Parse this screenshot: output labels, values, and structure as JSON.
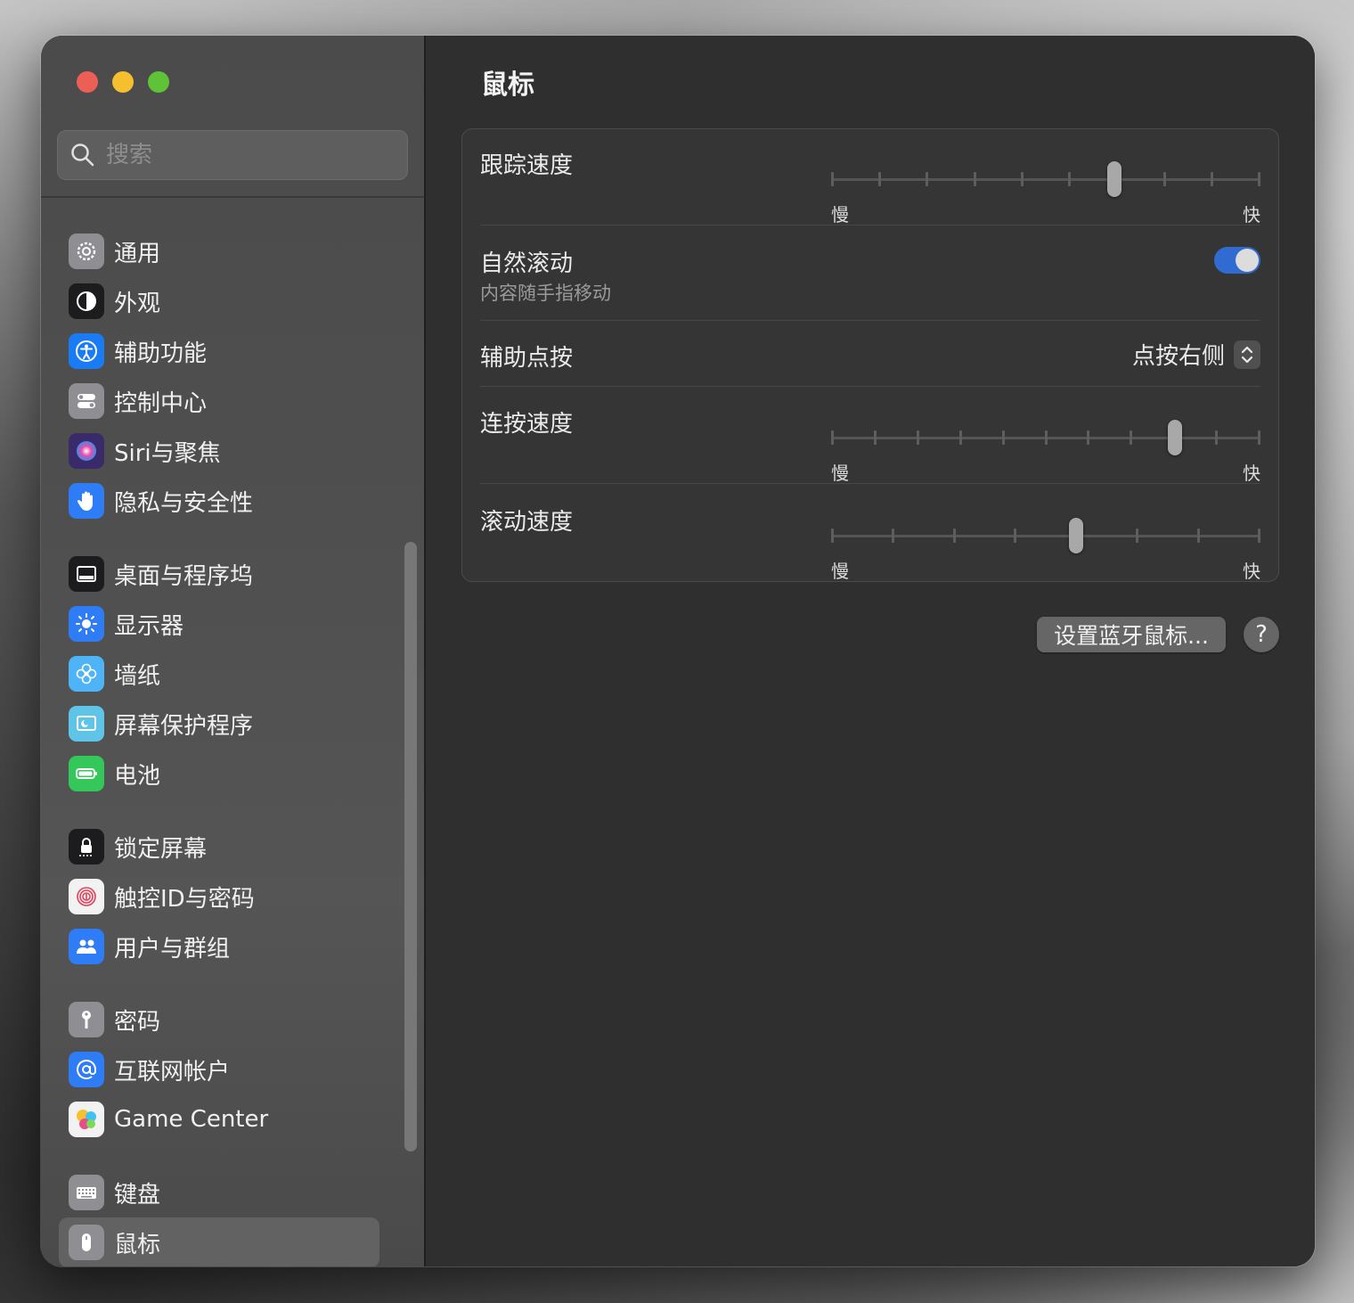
{
  "window": {
    "traffic_lights": [
      "close",
      "minimize",
      "zoom"
    ]
  },
  "search": {
    "placeholder": "搜索"
  },
  "sidebar": {
    "groups": [
      [
        {
          "label": "通用",
          "icon": "gear-icon",
          "color": "#8e8e93"
        },
        {
          "label": "外观",
          "icon": "appearance-icon",
          "color": "#1c1c1e"
        },
        {
          "label": "辅助功能",
          "icon": "accessibility-icon",
          "color": "#1a7cf5"
        },
        {
          "label": "控制中心",
          "icon": "control-center-icon",
          "color": "#8e8e93"
        },
        {
          "label": "Siri与聚焦",
          "icon": "siri-icon",
          "color": "#3a2a6a"
        },
        {
          "label": "隐私与安全性",
          "icon": "hand-icon",
          "color": "#2e7cf6"
        }
      ],
      [
        {
          "label": "桌面与程序坞",
          "icon": "dock-icon",
          "color": "#1c1c1e"
        },
        {
          "label": "显示器",
          "icon": "sun-icon",
          "color": "#2e7cf6"
        },
        {
          "label": "墙纸",
          "icon": "flower-icon",
          "color": "#4fb3f7"
        },
        {
          "label": "屏幕保护程序",
          "icon": "screensaver-icon",
          "color": "#5ec4e8"
        },
        {
          "label": "电池",
          "icon": "battery-icon",
          "color": "#34c759"
        }
      ],
      [
        {
          "label": "锁定屏幕",
          "icon": "lock-icon",
          "color": "#1c1c1e"
        },
        {
          "label": "触控ID与密码",
          "icon": "fingerprint-icon",
          "color": "#f2f2f2"
        },
        {
          "label": "用户与群组",
          "icon": "users-icon",
          "color": "#2e7cf6"
        }
      ],
      [
        {
          "label": "密码",
          "icon": "key-icon",
          "color": "#8e8e93"
        },
        {
          "label": "互联网帐户",
          "icon": "at-icon",
          "color": "#2e7cf6"
        },
        {
          "label": "Game Center",
          "icon": "game-center-icon",
          "color": "#f2f2f2"
        }
      ],
      [
        {
          "label": "键盘",
          "icon": "keyboard-icon",
          "color": "#8e8e93"
        },
        {
          "label": "鼠标",
          "icon": "mouse-icon",
          "color": "#8e8e93",
          "active": true
        }
      ]
    ]
  },
  "main": {
    "title": "鼠标",
    "tracking_speed": {
      "label": "跟踪速度",
      "min_label": "慢",
      "max_label": "快",
      "ticks": 10,
      "value": 0.66
    },
    "natural_scrolling": {
      "label": "自然滚动",
      "sublabel": "内容随手指移动",
      "enabled": true
    },
    "secondary_click": {
      "label": "辅助点按",
      "value": "点按右侧"
    },
    "double_click_speed": {
      "label": "连按速度",
      "min_label": "慢",
      "max_label": "快",
      "ticks": 11,
      "value": 0.8
    },
    "scroll_speed": {
      "label": "滚动速度",
      "min_label": "慢",
      "max_label": "快",
      "ticks": 8,
      "value": 0.571
    },
    "setup_bluetooth_button": "设置蓝牙鼠标...",
    "help_button": "?"
  },
  "colors": {
    "accent": "#2f6bd0",
    "window_bg": "#2f2f2f",
    "sidebar_bg": "#4f4f4f"
  }
}
